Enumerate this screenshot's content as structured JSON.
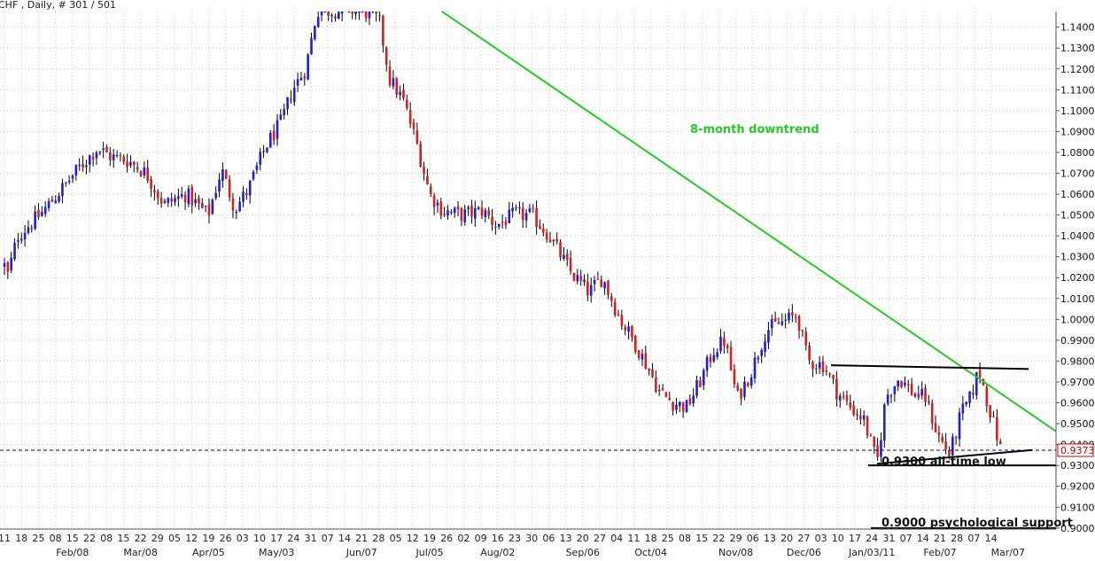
{
  "header": {
    "title": "CHF , Daily, # 301 / 501"
  },
  "chart_data": {
    "type": "candlestick",
    "ylim": [
      0.8995,
      1.1475
    ],
    "y_ticks": [
      "1.1400",
      "1.1300",
      "1.1200",
      "1.1100",
      "1.1000",
      "1.0900",
      "1.0800",
      "1.0700",
      "1.0600",
      "1.0500",
      "1.0400",
      "1.0300",
      "1.0200",
      "1.0100",
      "1.0000",
      "0.9900",
      "0.9800",
      "0.9700",
      "0.9600",
      "0.9500",
      "0.9400",
      "0.9300",
      "0.9200",
      "0.9100",
      "0.9000"
    ],
    "current_price": "0.9373",
    "up_color": "#1f1fd6",
    "down_color": "#d61f1f",
    "x_day_labels": [
      "11",
      "18",
      "25",
      "08",
      "15",
      "22",
      "08",
      "15",
      "22",
      "29",
      "05",
      "12",
      "19",
      "26",
      "03",
      "10",
      "17",
      "24",
      "31",
      "07",
      "14",
      "21",
      "28",
      "05",
      "12",
      "19",
      "26",
      "02",
      "09",
      "16",
      "23",
      "30",
      "06",
      "13",
      "20",
      "27",
      "04",
      "11",
      "18",
      "25",
      "08",
      "15",
      "22",
      "29",
      "06",
      "13",
      "20",
      "27",
      "03",
      "10",
      "17",
      "24",
      "31",
      "07",
      "14",
      "21",
      "28",
      "07",
      "14"
    ],
    "x_month_labels": [
      "Feb/08",
      "Mar/08",
      "Apr/05",
      "May/03",
      "Jun/07",
      "Jul/05",
      "Aug/02",
      "Sep/06",
      "Oct/04",
      "Nov/08",
      "Dec/06",
      "Jan/03/11",
      "Feb/07",
      "Mar/07"
    ],
    "anchors": [
      {
        "x": 0,
        "v": 1.035
      },
      {
        "x": 8,
        "v": 1.02
      },
      {
        "x": 20,
        "v": 1.04
      },
      {
        "x": 45,
        "v": 1.05
      },
      {
        "x": 65,
        "v": 1.06
      },
      {
        "x": 88,
        "v": 1.072
      },
      {
        "x": 110,
        "v": 1.082
      },
      {
        "x": 125,
        "v": 1.078
      },
      {
        "x": 145,
        "v": 1.076
      },
      {
        "x": 165,
        "v": 1.07
      },
      {
        "x": 185,
        "v": 1.055
      },
      {
        "x": 210,
        "v": 1.06
      },
      {
        "x": 235,
        "v": 1.05
      },
      {
        "x": 250,
        "v": 1.072
      },
      {
        "x": 265,
        "v": 1.053
      },
      {
        "x": 280,
        "v": 1.062
      },
      {
        "x": 300,
        "v": 1.083
      },
      {
        "x": 318,
        "v": 1.095
      },
      {
        "x": 330,
        "v": 1.11
      },
      {
        "x": 345,
        "v": 1.12
      },
      {
        "x": 358,
        "v": 1.148
      },
      {
        "x": 410,
        "v": 1.148
      },
      {
        "x": 428,
        "v": 1.143
      },
      {
        "x": 440,
        "v": 1.115
      },
      {
        "x": 455,
        "v": 1.105
      },
      {
        "x": 470,
        "v": 1.085
      },
      {
        "x": 485,
        "v": 1.06
      },
      {
        "x": 500,
        "v": 1.052
      },
      {
        "x": 520,
        "v": 1.05
      },
      {
        "x": 545,
        "v": 1.052
      },
      {
        "x": 560,
        "v": 1.045
      },
      {
        "x": 580,
        "v": 1.05
      },
      {
        "x": 600,
        "v": 1.05
      },
      {
        "x": 620,
        "v": 1.04
      },
      {
        "x": 645,
        "v": 1.022
      },
      {
        "x": 665,
        "v": 1.013
      },
      {
        "x": 680,
        "v": 1.02
      },
      {
        "x": 700,
        "v": 1.0
      },
      {
        "x": 715,
        "v": 0.99
      },
      {
        "x": 730,
        "v": 0.978
      },
      {
        "x": 745,
        "v": 0.965
      },
      {
        "x": 760,
        "v": 0.96
      },
      {
        "x": 775,
        "v": 0.958
      },
      {
        "x": 790,
        "v": 0.97
      },
      {
        "x": 805,
        "v": 0.985
      },
      {
        "x": 818,
        "v": 0.99
      },
      {
        "x": 832,
        "v": 0.962
      },
      {
        "x": 848,
        "v": 0.975
      },
      {
        "x": 865,
        "v": 0.995
      },
      {
        "x": 880,
        "v": 0.998
      },
      {
        "x": 900,
        "v": 1.002
      },
      {
        "x": 912,
        "v": 0.98
      },
      {
        "x": 930,
        "v": 0.978
      },
      {
        "x": 945,
        "v": 0.965
      },
      {
        "x": 960,
        "v": 0.958
      },
      {
        "x": 975,
        "v": 0.952
      },
      {
        "x": 990,
        "v": 0.931
      },
      {
        "x": 1000,
        "v": 0.963
      },
      {
        "x": 1015,
        "v": 0.972
      },
      {
        "x": 1030,
        "v": 0.965
      },
      {
        "x": 1045,
        "v": 0.962
      },
      {
        "x": 1058,
        "v": 0.945
      },
      {
        "x": 1072,
        "v": 0.935
      },
      {
        "x": 1085,
        "v": 0.955
      },
      {
        "x": 1095,
        "v": 0.962
      },
      {
        "x": 1105,
        "v": 0.976
      },
      {
        "x": 1115,
        "v": 0.96
      },
      {
        "x": 1130,
        "v": 0.937
      }
    ],
    "lines": [
      {
        "name": "downtrend",
        "color": "#22cc22",
        "x1": 499,
        "v1": 1.1475,
        "x2": 1195,
        "v2": 0.9455
      },
      {
        "name": "resistance",
        "color": "#000000",
        "x1": 938,
        "v1": 0.978,
        "x2": 1161,
        "v2": 0.9762
      },
      {
        "name": "rising-support",
        "color": "#000000",
        "x1": 990,
        "v1": 0.9308,
        "x2": 1165,
        "v2": 0.9374
      },
      {
        "name": "low-support",
        "color": "#000000",
        "x1": 980,
        "v1": 0.93,
        "x2": 1195,
        "v2": 0.93
      },
      {
        "name": "psych-support",
        "color": "#000000",
        "x1": 983,
        "v1": 0.9,
        "x2": 1195,
        "v2": 0.9
      }
    ],
    "annotations": {
      "downtrend": "8-month downtrend",
      "low": "0.9300 all-time low",
      "psych": "0.9000 psychological support"
    }
  }
}
